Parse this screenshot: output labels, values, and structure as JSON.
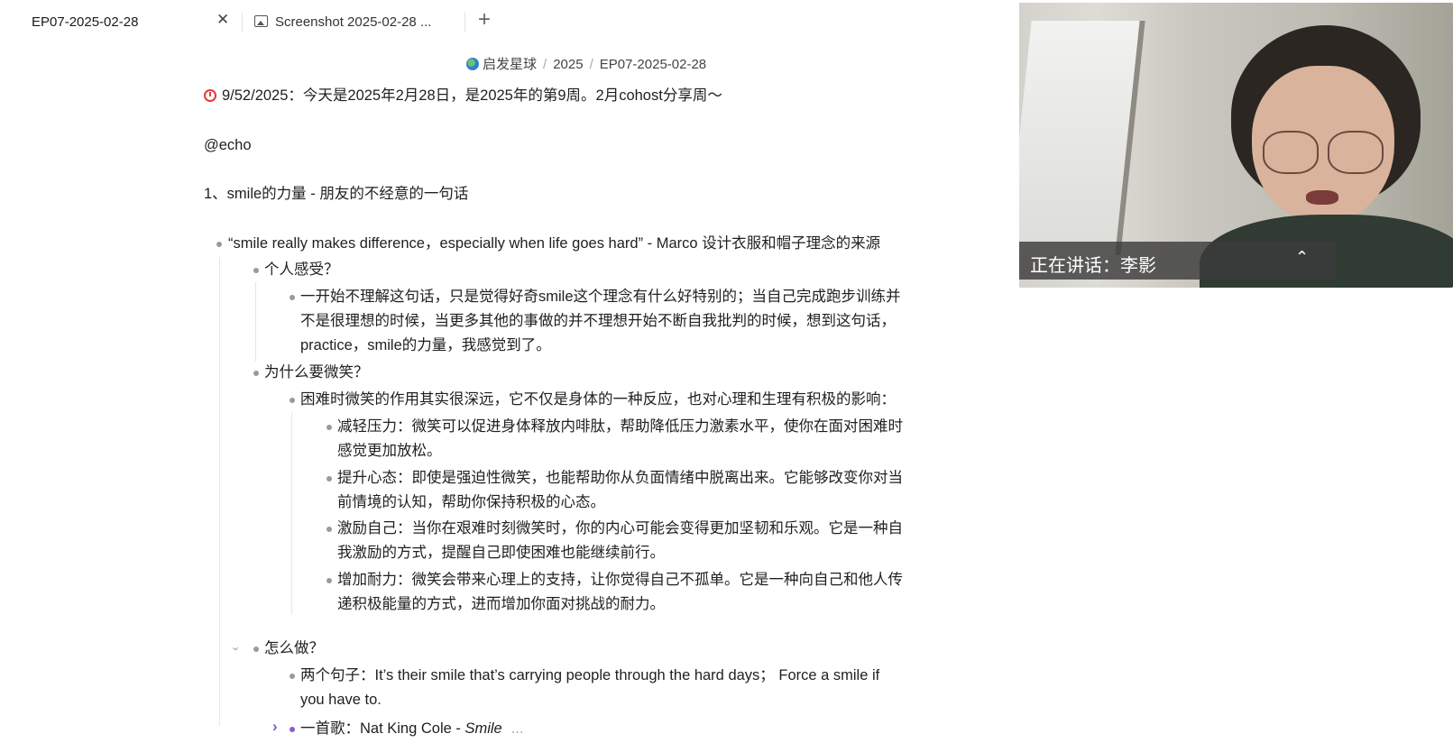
{
  "tabs": {
    "active_title": "EP07-2025-02-28",
    "close_glyph": "✕",
    "second_title": "Screenshot 2025-02-28 ...",
    "add_glyph": "+"
  },
  "breadcrumb": {
    "items": [
      "启发星球",
      "2025",
      "EP07-2025-02-28"
    ],
    "separator": "/"
  },
  "document": {
    "header_line": "9/52/2025：今天是2025年2月28日，是2025年的第9周。2月cohost分享周～",
    "mention": "@echo",
    "section_heading": "1、smile的力量 - 朋友的不经意的一句话",
    "quote_bullet": "“smile really makes difference，especially when life goes hard” - Marco 设计衣服和帽子理念的来源",
    "feeling_heading": "个人感受？",
    "feeling_text_1": "一开始不理解这句话，只是觉得好奇smile这个理念有什么好特别的；当自己完成跑步训练并",
    "feeling_text_2": "不是很理想的时候，当更多其他的事做的并不理想开始不断自我批判的时候，想到这句话，",
    "feeling_text_3": "practice，smile的力量，我感觉到了。",
    "why_heading": "为什么要微笑？",
    "why_intro": "困难时微笑的作用其实很深远，它不仅是身体的一种反应，也对心理和生理有积极的影响：",
    "point_1a": "减轻压力：微笑可以促进身体释放内啡肽，帮助降低压力激素水平，使你在面对困难时",
    "point_1b": "感觉更加放松。",
    "point_2a": "提升心态：即使是强迫性微笑，也能帮助你从负面情绪中脱离出来。它能够改变你对当",
    "point_2b": "前情境的认知，帮助你保持积极的心态。",
    "point_3a": "激励自己：当你在艰难时刻微笑时，你的内心可能会变得更加坚韧和乐观。它是一种自",
    "point_3b": "我激励的方式，提醒自己即使困难也能继续前行。",
    "point_4a": "增加耐力：微笑会带来心理上的支持，让你觉得自己不孤单。它是一种向自己和他人传",
    "point_4b": "递积极能量的方式，进而增加你面对挑战的耐力。",
    "how_heading": "怎么做？",
    "how_sentences_1": "两个句子：It’s their smile that’s carrying people through the hard days； Force a smile if",
    "how_sentences_2": "you have to.",
    "song_prefix": "一首歌：Nat King Cole - ",
    "song_title": "Smile",
    "song_more": "..."
  },
  "video": {
    "speaker_label": "正在讲话：李影",
    "collapse_glyph": "⌃"
  },
  "colors": {
    "accent_purple": "#8a5bd6",
    "alarm_red": "#e23a3a",
    "bullet_gray": "#9a9a9a"
  }
}
